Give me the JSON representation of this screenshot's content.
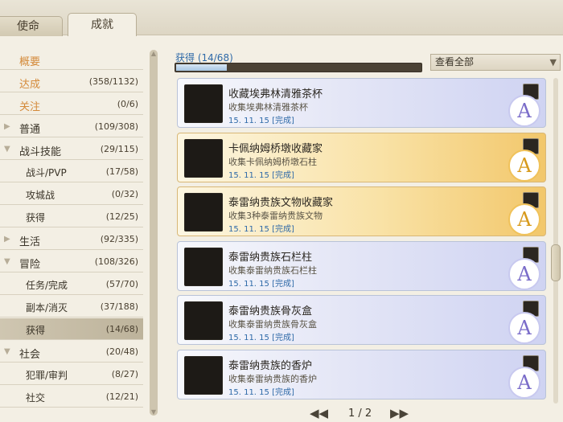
{
  "tabs": [
    {
      "label": "使命",
      "active": false
    },
    {
      "label": "成就",
      "active": true
    }
  ],
  "sidebar": {
    "items": [
      {
        "label": "概要",
        "count": "",
        "kind": "top",
        "highlight": true
      },
      {
        "label": "达成",
        "count": "(358/1132)",
        "kind": "top",
        "highlight": true
      },
      {
        "label": "关注",
        "count": "(0/6)",
        "kind": "top",
        "highlight": true
      },
      {
        "label": "普通",
        "count": "(109/308)",
        "kind": "cat",
        "arrow": "▶"
      },
      {
        "label": "战斗技能",
        "count": "(29/115)",
        "kind": "cat",
        "arrow": "▼"
      },
      {
        "label": "战斗/PVP",
        "count": "(17/58)",
        "kind": "sub"
      },
      {
        "label": "攻城战",
        "count": "(0/32)",
        "kind": "sub"
      },
      {
        "label": "获得",
        "count": "(12/25)",
        "kind": "sub"
      },
      {
        "label": "生活",
        "count": "(92/335)",
        "kind": "cat",
        "arrow": "▶"
      },
      {
        "label": "冒险",
        "count": "(108/326)",
        "kind": "cat",
        "arrow": "▼"
      },
      {
        "label": "任务/完成",
        "count": "(57/70)",
        "kind": "sub"
      },
      {
        "label": "副本/消灭",
        "count": "(37/188)",
        "kind": "sub"
      },
      {
        "label": "获得",
        "count": "(14/68)",
        "kind": "sub",
        "selected": true
      },
      {
        "label": "社会",
        "count": "(20/48)",
        "kind": "cat",
        "arrow": "▼"
      },
      {
        "label": "犯罪/审判",
        "count": "(8/27)",
        "kind": "sub"
      },
      {
        "label": "社交",
        "count": "(12/21)",
        "kind": "sub"
      }
    ]
  },
  "progress": {
    "label": "获得 (14/68)",
    "fraction": 0.206
  },
  "filter": {
    "selected": "查看全部"
  },
  "achievements": [
    {
      "title": "收藏埃弗林清雅茶杯",
      "desc": "收集埃弗林清雅茶杯",
      "date": "15. 11. 15 [完成]",
      "style": "blue",
      "icon": "teacup-icon"
    },
    {
      "title": "卡佩纳姆桥墩收藏家",
      "desc": "收集卡佩纳姆桥墩石柱",
      "date": "15. 11. 15 [完成]",
      "style": "gold",
      "icon": "pillar-icon"
    },
    {
      "title": "泰雷纳贵族文物收藏家",
      "desc": "收集3种泰雷纳贵族文物",
      "date": "15. 11. 15 [完成]",
      "style": "gold",
      "icon": "relic-icon"
    },
    {
      "title": "泰雷纳贵族石栏柱",
      "desc": "收集泰雷纳贵族石栏柱",
      "date": "15. 11. 15 [完成]",
      "style": "blue",
      "icon": "baluster-icon"
    },
    {
      "title": "泰雷纳贵族骨灰盒",
      "desc": "收集泰雷纳贵族骨灰盒",
      "date": "15. 11. 15 [完成]",
      "style": "blue",
      "icon": "urn-icon"
    },
    {
      "title": "泰雷纳贵族的香炉",
      "desc": "收集泰雷纳贵族的香炉",
      "date": "15. 11. 15 [完成]",
      "style": "blue",
      "icon": "censer-icon"
    }
  ],
  "emblem_glyph": "A",
  "pager": {
    "current": "1 / 2",
    "first": "◀◀",
    "last": "▶▶"
  },
  "colors": {
    "accent_orange": "#d48a3a",
    "link_blue": "#2f6aa8",
    "gold_card": "#f2c76b",
    "blue_card": "#cfd3f2"
  }
}
